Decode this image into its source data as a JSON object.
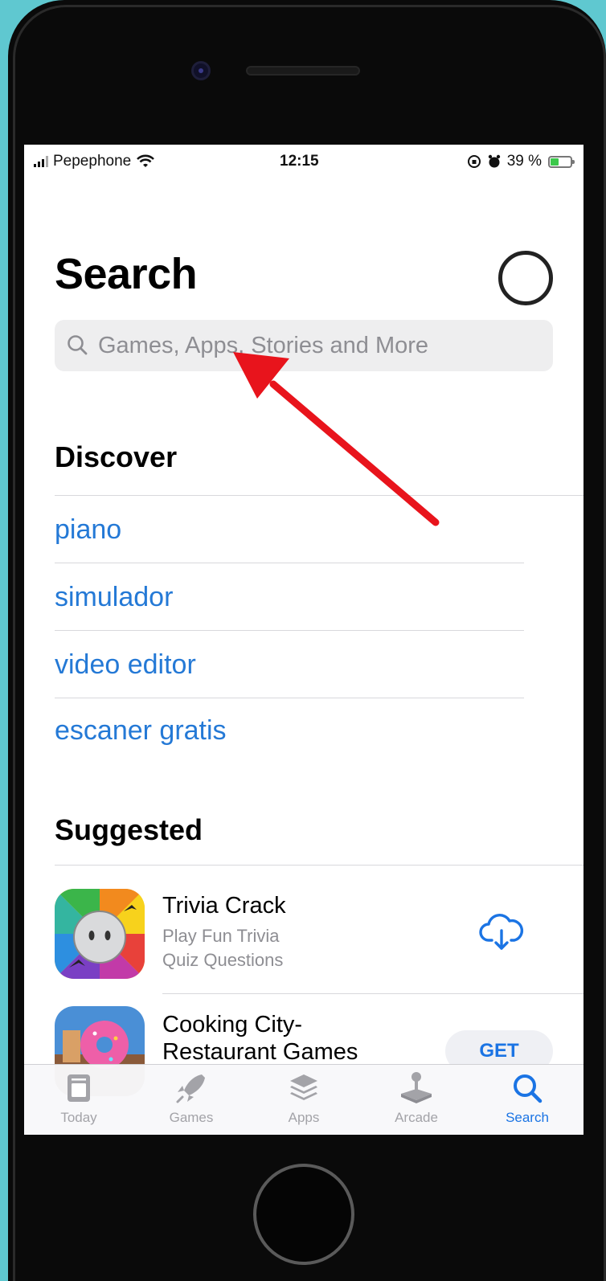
{
  "status_bar": {
    "carrier": "Pepephone",
    "time": "12:15",
    "battery": "39 %"
  },
  "page": {
    "title": "Search"
  },
  "search": {
    "placeholder": "Games, Apps, Stories and More"
  },
  "discover": {
    "heading": "Discover",
    "items": [
      "piano",
      "simulador",
      "video editor",
      "escaner gratis"
    ]
  },
  "suggested": {
    "heading": "Suggested",
    "apps": [
      {
        "name": "Trivia Crack",
        "subtitle_line1": "Play Fun Trivia",
        "subtitle_line2": "Quiz Questions",
        "action": "download-cloud-icon"
      },
      {
        "name_line1": "Cooking City-",
        "name_line2": "Restaurant Games",
        "action_label": "GET"
      }
    ]
  },
  "tab_bar": {
    "tabs": [
      {
        "label": "Today",
        "icon": "today-icon",
        "active": false
      },
      {
        "label": "Games",
        "icon": "rocket-icon",
        "active": false
      },
      {
        "label": "Apps",
        "icon": "layers-icon",
        "active": false
      },
      {
        "label": "Arcade",
        "icon": "joystick-icon",
        "active": false
      },
      {
        "label": "Search",
        "icon": "search-icon",
        "active": true
      }
    ]
  },
  "colors": {
    "accent": "#1b74e4",
    "link": "#2479d6",
    "annotation_arrow": "#e8141c",
    "background_border": "#5fc8d0"
  }
}
